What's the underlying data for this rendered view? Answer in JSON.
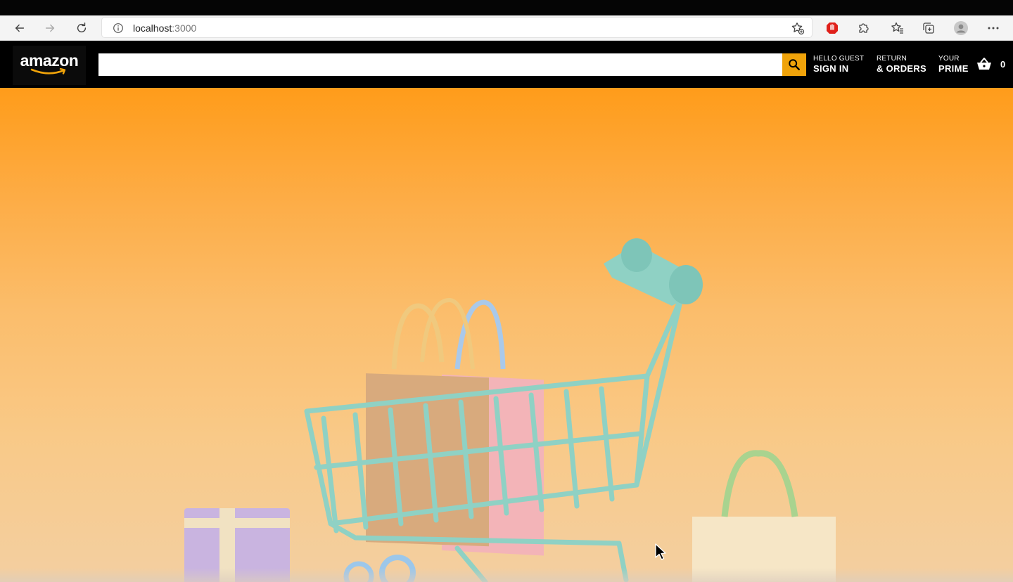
{
  "browser": {
    "url_host": "localhost",
    "url_port": ":3000"
  },
  "header": {
    "logo_text": "amazon",
    "search": {
      "value": "",
      "placeholder": ""
    },
    "signin": {
      "line1": "HELLO GUEST",
      "line2": "SIGN IN"
    },
    "orders": {
      "line1": "RETURN",
      "line2": "& ORDERS"
    },
    "prime": {
      "line1": "YOUR",
      "line2": "PRIME"
    },
    "basket_count": "0"
  },
  "colors": {
    "header_bg": "#000000",
    "search_button": "#f0a30a",
    "hero_top": "#ff9c1a",
    "hero_bottom": "#f3cfa1"
  },
  "icons": {
    "back": "back-arrow-icon",
    "forward": "forward-arrow-icon",
    "reload": "reload-icon",
    "info": "info-icon",
    "favorite": "add-favorite-icon",
    "adblock": "adblock-icon",
    "extensions": "extensions-icon",
    "favorites": "favorites-icon",
    "collections": "collections-icon",
    "profile": "profile-icon",
    "menu": "more-menu-icon",
    "search": "search-icon",
    "basket": "shopping-basket-icon",
    "cursor": "mouse-cursor-icon"
  }
}
